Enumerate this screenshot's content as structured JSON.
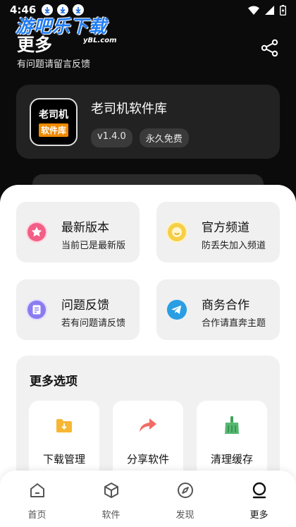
{
  "status": {
    "time": "4:46"
  },
  "watermark": {
    "main": "游吧乐下载",
    "sub": "yBL.com"
  },
  "header": {
    "title": "更多",
    "subtitle": "有问题请留言反馈"
  },
  "app": {
    "icon_line1": "老司机",
    "icon_line2": "软件库",
    "name": "老司机软件库",
    "tags": [
      "v1.4.0",
      "永久免费"
    ]
  },
  "features": [
    {
      "title": "最新版本",
      "subtitle": "当前已是最新版",
      "icon": "star-icon",
      "color": "#f25f86"
    },
    {
      "title": "官方频道",
      "subtitle": "防丢失加入频道",
      "icon": "smile-icon",
      "color": "#f6cf46"
    },
    {
      "title": "问题反馈",
      "subtitle": "若有问题请反馈",
      "icon": "feedback-icon",
      "color": "#8a7cf0"
    },
    {
      "title": "商务合作",
      "subtitle": "合作请直奔主题",
      "icon": "telegram-icon",
      "color": "#2a9ee3"
    }
  ],
  "more_options": {
    "title": "更多选项",
    "items": [
      {
        "label": "下载管理",
        "icon": "download-folder-icon"
      },
      {
        "label": "分享软件",
        "icon": "share-arrow-icon"
      },
      {
        "label": "清理缓存",
        "icon": "broom-icon"
      }
    ]
  },
  "nav": [
    {
      "label": "首页",
      "icon": "home-icon",
      "active": false
    },
    {
      "label": "软件",
      "icon": "cube-icon",
      "active": false
    },
    {
      "label": "发现",
      "icon": "compass-icon",
      "active": false
    },
    {
      "label": "更多",
      "icon": "user-icon",
      "active": true
    }
  ],
  "colors": {
    "accent_orange": "#f08a00",
    "card_dark": "#222222",
    "sheet_bg": "#ffffff"
  }
}
